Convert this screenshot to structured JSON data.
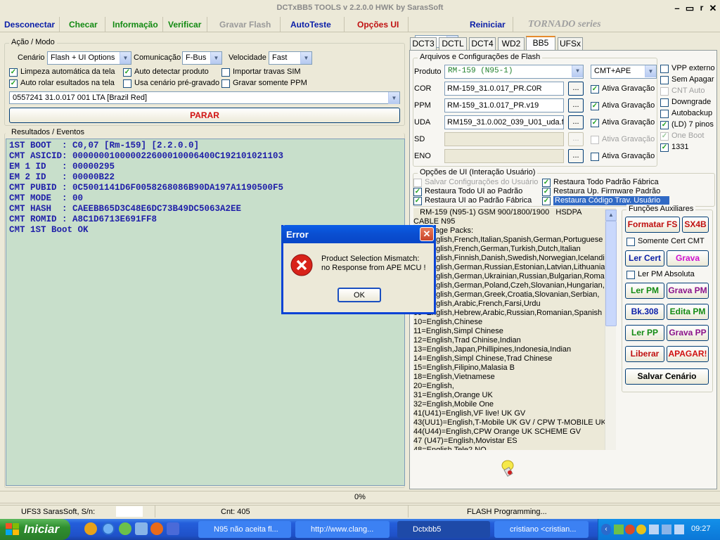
{
  "title": "DCTxBB5 TOOLS v 2.2.0.0 HWK by SarasSoft",
  "menu": {
    "desconectar": "Desconectar",
    "checar": "Checar",
    "informacao": "Informação",
    "verificar": "Verificar",
    "gravar_flash": "Gravar Flash",
    "autoteste": "AutoTeste",
    "opcoes_ui": "Opções UI",
    "reiniciar": "Reiniciar",
    "tornado": "TORNADO series",
    "help_value": "?"
  },
  "acao": {
    "legend": "Ação / Modo",
    "cenario_label": "Cenário",
    "cenario_value": "Flash + UI Options",
    "comunicacao_label": "Comunicação",
    "comunicacao_value": "F-Bus",
    "velocidade_label": "Velocidade",
    "velocidade_value": "Fast",
    "cb_limpeza": "Limpeza automática da tela",
    "cb_auto_detectar": "Auto detectar produto",
    "cb_importar": "Importar travas SIM",
    "cb_auto_rolar": "Auto rolar esultados na tela",
    "cb_usa_cenario": "Usa cenário pré-gravado",
    "cb_gravar_ppm": "Gravar somente PPM",
    "product_line": "0557241 31.0.017 001 LTA [Brazil Red]",
    "parar": "PARAR"
  },
  "results": {
    "legend": "Resultados / Eventos",
    "log": "1ST BOOT  : C0,07 [Rm-159] [2.2.0.0]\nCMT ASICID: 000000010000022600010006400C192101021103\nEM 1 ID   : 00000295\nEM 2 ID   : 00000B22\nCMT PUBID : 0C5001141D6F0058268086B90DA197A1190500F5\nCMT MODE  : 00\nCMT HASH  : CAEEBB65D3C48E6DC73B49DC5063A2EE\nCMT ROMID : A8C1D6713E691FF8\nCMT 1ST Boot OK"
  },
  "tabs": [
    "DCT3",
    "DCTL",
    "DCT4",
    "WD2",
    "BB5",
    "UFSx"
  ],
  "files": {
    "legend": "Arquivos e Configurações de Flash",
    "produto_label": "Produto",
    "produto_value": "RM-159  (N95-1)",
    "cmt_value": "CMT+APE",
    "cor_label": "COR",
    "cor_value": "RM-159_31.0.017_PR.C0R",
    "ppm_label": "PPM",
    "ppm_value": "RM-159_31.0.017_PR.v19",
    "uda_label": "UDA",
    "uda_value": "RM159_31.0.002_039_U01_uda.f",
    "sd_label": "SD",
    "eno_label": "ENO",
    "ativa": "Ativa Gravação",
    "dots": "..."
  },
  "right_opts": {
    "vpp": "VPP externo",
    "sem_apagar": "Sem Apagar",
    "cnt_auto": "CNT Auto",
    "downgrade": "Downgrade",
    "autobackup": "Autobackup",
    "ld7": "(LD) 7 pinos",
    "one_boot": "One Boot",
    "o1331": "1331"
  },
  "ui_opts": {
    "legend": "Opções de UI (Interação Usuário)",
    "salvar": "Salvar Configurações do Usuário",
    "rest_todo_ui": "Restaura Todo UI ao Padrão",
    "rest_ui": "Restaura UI ao Padrão Fábrica",
    "rest_todo_padrao": "Restaura Todo Padrão Fábrica",
    "rest_up": "Restaura Up. Firmware Padrão",
    "rest_codigo": "Restaura Código Trav. Usuário"
  },
  "langs": "   RM-159 (N95-1) GSM 900/1800/1900   HSDPA\nCABLE N95\nLanguage Packs:\n01=English,French,Italian,Spanish,German,Portuguese\n02=English,French,German,Turkish,Dutch,Italian\n03=English,Finnish,Danish,Swedish,Norwegian,Icelandic\n04=English,German,Russian,Estonian,Latvian,Lithuanian\n05=English,German,Ukrainian,Russian,Bulgarian,Romania\n06=English,German,Poland,Czeh,Slovanian,Hungarian,\n07=English,German,Greek,Croatia,Slovanian,Serbian,\n08=English,Arabic,French,Farsi,Urdu\n09=English,Hebrew,Arabic,Russian,Romanian,Spanish\n10=English,Chinese\n11=English,Simpl Chinese\n12=English,Trad Chinise,Indian\n13=English,Japan,Phillipines,Indonesia,Indian\n14=English,Simpl Chinese,Trad Chinese\n15=English,Filipino,Malasia B\n18=English,Vietnamese\n20=English,\n31=English,Orange UK\n32=English,Mobile One\n41(U41)=English,VF live! UK GV\n43(UU1)=English,T-Mobile UK GV / CPW T-MOBILE UK\n44(U44)=English,CPW Orange UK SCHEME GV\n47 (U47)=English,Movistar ES\n48=English,Tele2 NO",
  "aux": {
    "legend": "Funções Auxiliares",
    "formatar": "Formatar FS",
    "sx4b": "SX4B",
    "somente_cert": "Somente Cert CMT",
    "ler_cert": "Ler Cert",
    "grava_cert": "Grava Cert",
    "ler_pm_abs": "Ler PM Absoluta",
    "ler_pm": "Ler PM",
    "grava_pm": "Grava PM",
    "bk308": "Bk.308",
    "edita_pm": "Edita PM",
    "ler_pp": "Ler PP",
    "grava_pp": "Grava PP",
    "liberar": "Liberar",
    "apagar": "APAGAR!",
    "salvar_cenario": "Salvar Cenário"
  },
  "progress": {
    "value": "0%",
    "fraction": 0
  },
  "status": {
    "left": "UFS3 SarasSoft, S/n:",
    "cnt": "Cnt: 405",
    "right": "FLASH Programming..."
  },
  "dialog": {
    "title": "Error",
    "line1": "Product Selection Mismatch:",
    "line2": "no Response from APE MCU !",
    "ok": "OK"
  },
  "taskbar": {
    "start": "Iniciar",
    "items": [
      "N95 não aceita fl...",
      "http://www.clang...",
      "Dctxbb5",
      "cristiano <cristian..."
    ],
    "clock": "09:27"
  },
  "colors": {
    "menu_blue": "#0a1ea8",
    "menu_green": "#128a12",
    "menu_red": "#c01010",
    "log_bg": "#c8dfcb"
  }
}
